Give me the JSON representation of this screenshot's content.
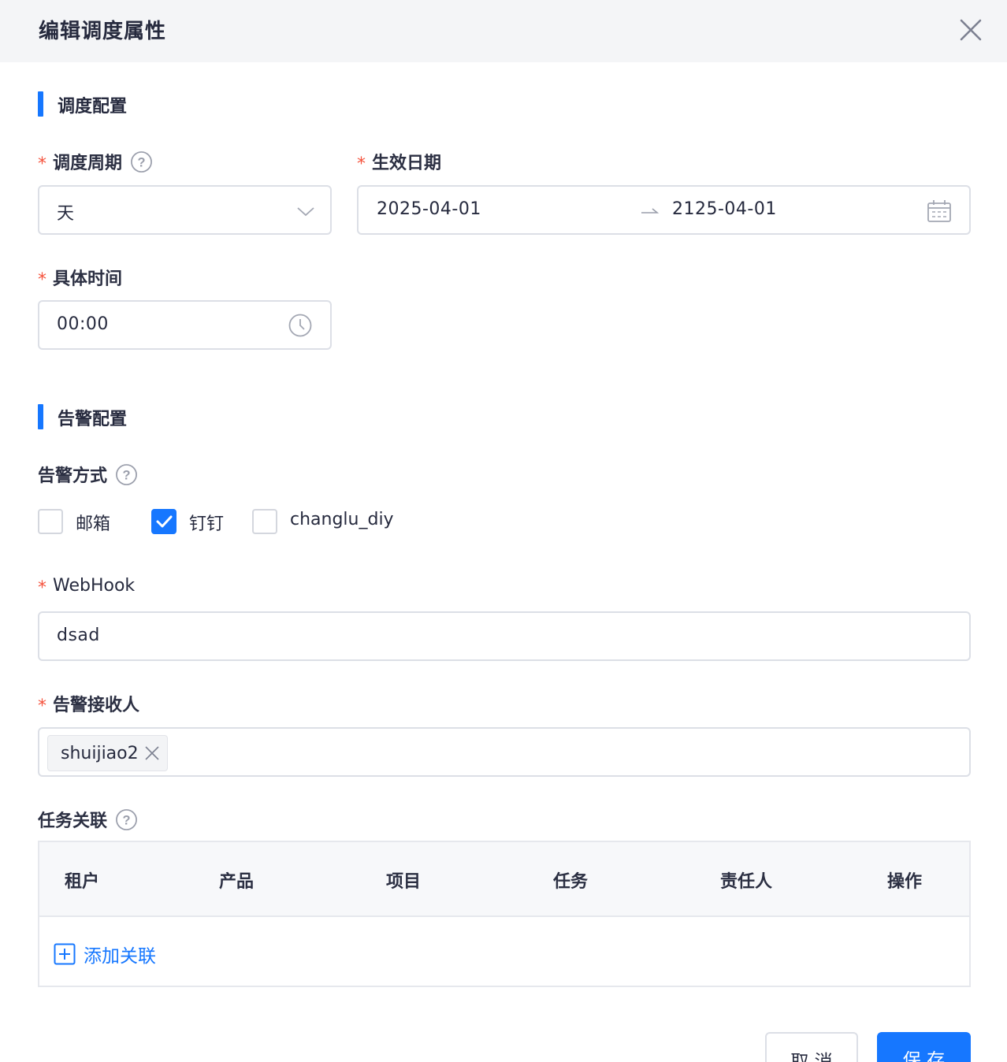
{
  "dialog": {
    "title": "编辑调度属性"
  },
  "schedule_section": {
    "title": "调度配置"
  },
  "period": {
    "label": "调度周期",
    "value": "天",
    "required": true
  },
  "effective_date": {
    "label": "生效日期",
    "start": "2025-04-01",
    "end": "2125-04-01",
    "required": true
  },
  "time": {
    "label": "具体时间",
    "value": "00:00",
    "required": true
  },
  "alert_section": {
    "title": "告警配置"
  },
  "alert_method": {
    "label": "告警方式",
    "options": [
      {
        "label": "邮箱",
        "checked": false
      },
      {
        "label": "钉钉",
        "checked": true
      },
      {
        "label": "changlu_diy",
        "checked": false
      }
    ]
  },
  "webhook": {
    "label": "WebHook",
    "value": "dsad",
    "required": true
  },
  "receivers": {
    "label": "告警接收人",
    "tags": [
      "shuijiao2"
    ],
    "required": true
  },
  "task_link": {
    "label": "任务关联",
    "columns": [
      "租户",
      "产品",
      "项目",
      "任务",
      "责任人",
      "操作"
    ],
    "add_label": "添加关联"
  },
  "footer": {
    "cancel_label": "取 消",
    "save_label": "保 存"
  },
  "colors": {
    "accent": "#1677ff",
    "required": "#f5533d",
    "header_bg": "#f4f5f7"
  },
  "icons": [
    "close-icon",
    "help-icon",
    "chevron-down-icon",
    "arrow-right-icon",
    "calendar-icon",
    "clock-icon",
    "check-icon",
    "plus-square-icon"
  ]
}
